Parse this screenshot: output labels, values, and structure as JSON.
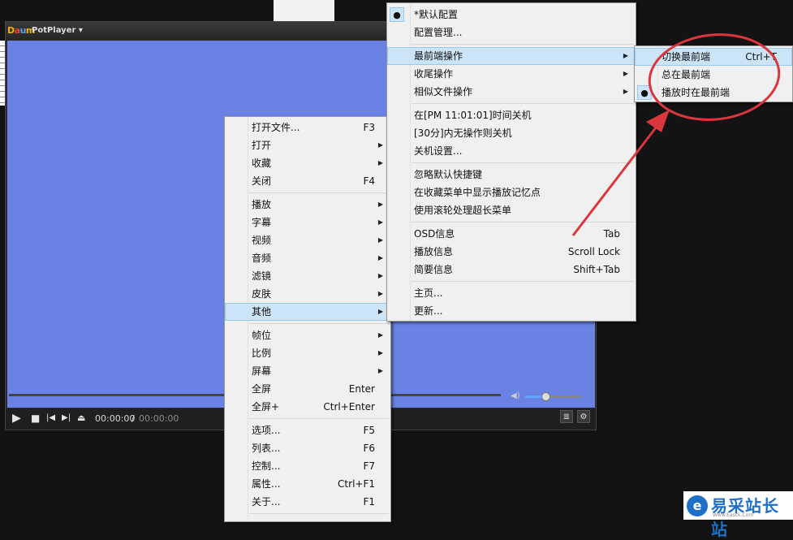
{
  "player": {
    "logo": [
      "D",
      "a",
      "u",
      "m"
    ],
    "name": "PotPlayer ▾",
    "time_current": "00:00:00",
    "time_sep": "/",
    "time_total": "00:00:00",
    "volume_level": 0.35,
    "colors": {
      "video": "#6a82e3",
      "accent": "#5ea7ff"
    }
  },
  "main_menu": {
    "items": [
      {
        "label": "打开文件...",
        "shortcut": "F3"
      },
      {
        "label": "打开",
        "submenu": true
      },
      {
        "label": "收藏",
        "submenu": true
      },
      {
        "label": "关闭",
        "shortcut": "F4"
      },
      {
        "label": "播放",
        "submenu": true
      },
      {
        "label": "字幕",
        "submenu": true
      },
      {
        "label": "视频",
        "submenu": true
      },
      {
        "label": "音频",
        "submenu": true
      },
      {
        "label": "滤镜",
        "submenu": true
      },
      {
        "label": "皮肤",
        "submenu": true
      },
      {
        "label": "其他",
        "submenu": true,
        "highlighted": true
      },
      {
        "label": "帧位",
        "submenu": true
      },
      {
        "label": "比例",
        "submenu": true
      },
      {
        "label": "屏幕",
        "submenu": true
      },
      {
        "label": "全屏",
        "shortcut": "Enter"
      },
      {
        "label": "全屏+",
        "shortcut": "Ctrl+Enter"
      },
      {
        "label": "选项...",
        "shortcut": "F5"
      },
      {
        "label": "列表...",
        "shortcut": "F6"
      },
      {
        "label": "控制...",
        "shortcut": "F7"
      },
      {
        "label": "属性...",
        "shortcut": "Ctrl+F1"
      },
      {
        "label": "关于...",
        "shortcut": "F1"
      }
    ]
  },
  "other_menu": {
    "items": [
      {
        "label": "*默认配置",
        "checked": true
      },
      {
        "label": "配置管理..."
      },
      {
        "label": "最前端操作",
        "submenu": true,
        "highlighted": true
      },
      {
        "label": "收尾操作",
        "submenu": true
      },
      {
        "label": "相似文件操作",
        "submenu": true
      },
      {
        "label": "在[PM 11:01:01]时间关机"
      },
      {
        "label": "[30分]内无操作则关机"
      },
      {
        "label": "关机设置..."
      },
      {
        "label": "忽略默认快捷键"
      },
      {
        "label": "在收藏菜单中显示播放记忆点"
      },
      {
        "label": "使用滚轮处理超长菜单"
      },
      {
        "label": "OSD信息",
        "shortcut": "Tab"
      },
      {
        "label": "播放信息",
        "shortcut": "Scroll Lock"
      },
      {
        "label": "简要信息",
        "shortcut": "Shift+Tab"
      },
      {
        "label": "主页..."
      },
      {
        "label": "更新..."
      }
    ]
  },
  "ontop_menu": {
    "items": [
      {
        "label": "切换最前端",
        "shortcut": "Ctrl+T",
        "highlighted": true
      },
      {
        "label": "总在最前端"
      },
      {
        "label": "播放时在最前端",
        "checked": true
      }
    ]
  },
  "icons": {
    "play": "play-icon",
    "stop": "stop-icon",
    "prev": "prev-icon",
    "next": "next-icon",
    "eject": "eject-icon",
    "volume": "volume-icon",
    "playlist": "playlist-icon",
    "settings": "gear-icon",
    "submenu": "chevron-right-icon",
    "check": "bullet-icon"
  },
  "watermark": {
    "text": "易采站长站",
    "sub": "Www.Easck.Com",
    "logo": "e"
  }
}
